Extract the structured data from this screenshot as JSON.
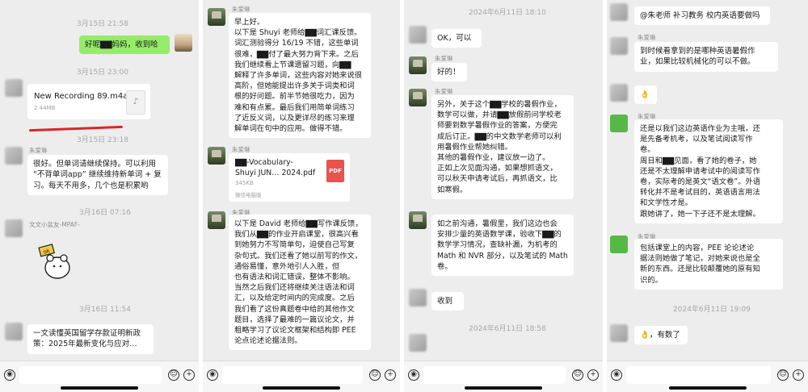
{
  "panel1": {
    "time1": "3月15日 21:58",
    "reply_green": "好呢▇▇妈妈，收到哈",
    "time2": "3月15日 23:00",
    "file_name": "New Recording 89.m4a",
    "file_size": "2.44MB",
    "time3": "3月15日 23:18",
    "sender": "朱爱琳",
    "msg1": "很好。但单词请继续保持。可以利用\n“不背单词app” 继续维持新单词 + 复\n习。每天不用多，几个也是积累哟",
    "time4": "3月16日 07:16",
    "sticker_sender": "文文小盆友-MPAF-",
    "sticker_label": "ok",
    "time5": "3月16日 11:54",
    "msg2": "一文读懂英国留学存款证明新政\n策：2025年最新变化与应对…"
  },
  "panel2": {
    "sender": "朱爱琳",
    "msg1": "早上好。\n以下是 Shuyi 老师给▇▇词汇课反馈。\n词汇测验得分 16/19 不错，这些单词\n很难，▇▇付了最大努力背下来。之后\n我们继续看上节课遗留习题，向▇▇\n解释了许多单词，这些内容对她来说很\n高阶，但她能提出许多关于词类和词\n根的好问题。前半节她很吃力，因为\n难和有点累。最后我们用简单词练习\n了近反义词，以及更详尽的练习来理\n解单词在句中的应用。做得不错。",
    "sender2": "朱爱琳",
    "file_name": "▇▇-Vocabulary-\nShuyi JUN… 2024.pdf",
    "file_size": "345KB",
    "file_source": "微信电脑版",
    "pdf_label": "PDF",
    "sender3": "朱爱琳",
    "msg2": "以下是 David 老师给▇▇写作课反馈，\n我们从▇▇的作业开启课堂，很高兴看\n到她努力不写简单句，迫使自己写复\n杂句式。我们还看了她以前写的作文，\n通俗易懂，意外地引人入胜，但\n也有语法和词汇错误，整体不影响。\n当然之后我们还将继续关注语法和词\n汇，以及给定时间内的完成度。之后\n我们看了这份真题卷中给的其他作文\n题目，选择了最难的一篇议论文，并\n粗略学习了议论文框架和结构即 PEE\n论点论述论据法则。"
  },
  "panel3": {
    "time1": "2024年6月11日 18:10",
    "reply1": "OK，可以",
    "sender": "朱爱琳",
    "msg1": "好的！",
    "sender2": "朱爱琳",
    "msg2": "另外，关于这个▇▇学校的暑假作业，\n数学可以做，并请▇▇放假前问学校老\n师要到数学暑假作业的答案，方便完\n成后订正。▇▇的中文数学老师可以利\n用暑假作业帮她纠错。\n其他的暑假作业，建议放一边了。\n正如上次见面沟通，如果想抓语文，\n可以秋天申请考试后，再抓语文，比\n如寒假。",
    "msg3": "如之前沟通，暑假里，我们这边也会\n安排少量的英语数学课，验收下▇▇的\n数学学习情况，查缺补漏，为机考的\nMath 和 NVR 部分，以及笔试的 Math\n卷。",
    "msg4": "收到",
    "time2": "2024年6月11日 18:58"
  },
  "panel4": {
    "msg1": "@朱老师 补习教务 校内英语要做吗",
    "sender": "朱爱琳",
    "msg2": "到时候看拿到的是哪种英语暑假作\n业，如果比较机械化的可以不做。",
    "msg3": "👌",
    "sender2": "朱爱琳",
    "msg4": "还是以我们这边英语作业为主哦，还\n是先备考机考，以及笔试阅读写作\n卷。\n周日和▇▇见面，看了她的卷子，她\n还是不太理解申请考试中的阅读写作\n卷，实际考的是英文“语文卷”。外语\n转化并不是考试目的，英语语言用法\n和文学性才是。\n跟她讲了，她一下子还不是太理解。",
    "sender3": "朱爱琳",
    "msg5": "包括课堂上的内容，PEE 论论述论\n据法则她做了笔记，对她来说也是全\n新的东西。还是比较颠覆她的原有知\n识的。",
    "time1": "2024年6月11日 19:09",
    "msg6": "👌，有数了"
  },
  "input": {
    "voice_icon": "voice-icon",
    "emoji_icon": "emoji-icon",
    "plus_icon": "plus-icon"
  },
  "colors": {
    "chat_bg": "#ededed",
    "bubble_self": "#95ec69",
    "bubble_other": "#ffffff",
    "pdf_red": "#e9534b",
    "strike_red": "#d9262a"
  }
}
